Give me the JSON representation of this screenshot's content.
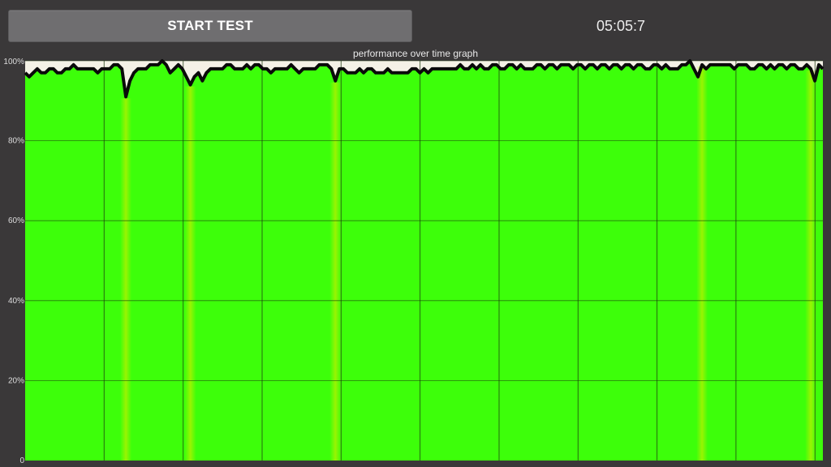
{
  "header": {
    "start_button_label": "START TEST",
    "timer": "05:05:7"
  },
  "chart_data": {
    "type": "area",
    "title": "performance over time graph",
    "xlabel": "",
    "ylabel": "",
    "ylim": [
      0,
      100
    ],
    "y_ticks": [
      "0",
      "20%",
      "40%",
      "60%",
      "80%",
      "100%"
    ],
    "y_tick_values": [
      0,
      20,
      40,
      60,
      80,
      100
    ],
    "x_gridlines": 10,
    "grid": true,
    "fill_color": "#3dff0a",
    "dip_color": "#b8f000",
    "line_color": "#0a0a0a",
    "background_color": "#f4f1e6",
    "series": [
      {
        "values": [
          97,
          96,
          97,
          98,
          97,
          97,
          98,
          98,
          97,
          97,
          98,
          98,
          99,
          98,
          98,
          98,
          98,
          98,
          97,
          98,
          98,
          98,
          99,
          99,
          98,
          91,
          95,
          97,
          98,
          98,
          98,
          99,
          99,
          99,
          100,
          99,
          97,
          98,
          99,
          98,
          96,
          94,
          96,
          97,
          95,
          97,
          98,
          98,
          98,
          98,
          99,
          99,
          98,
          98,
          98,
          99,
          98,
          99,
          99,
          98,
          98,
          97,
          98,
          98,
          98,
          98,
          99,
          98,
          97,
          98,
          98,
          98,
          98,
          99,
          99,
          99,
          98,
          95,
          98,
          98,
          97,
          97,
          97,
          98,
          97,
          98,
          98,
          97,
          97,
          97,
          98,
          97,
          97,
          97,
          97,
          97,
          98,
          98,
          97,
          98,
          97,
          98,
          98,
          98,
          98,
          98,
          98,
          98,
          99,
          98,
          98,
          99,
          98,
          99,
          98,
          98,
          99,
          99,
          98,
          98,
          99,
          99,
          98,
          99,
          98,
          98,
          98,
          99,
          99,
          98,
          99,
          99,
          98,
          99,
          99,
          99,
          98,
          99,
          99,
          98,
          99,
          99,
          98,
          99,
          99,
          98,
          99,
          99,
          98,
          99,
          99,
          98,
          99,
          99,
          98,
          98,
          99,
          99,
          98,
          99,
          98,
          98,
          98,
          99,
          99,
          100,
          98,
          96,
          99,
          98,
          99,
          99,
          99,
          99,
          99,
          99,
          98,
          99,
          99,
          99,
          98,
          98,
          99,
          99,
          98,
          99,
          98,
          99,
          99,
          98,
          99,
          99,
          98,
          98,
          99,
          98,
          95,
          99,
          98
        ]
      }
    ],
    "dip_positions": [
      25,
      41,
      77,
      168,
      195
    ]
  }
}
